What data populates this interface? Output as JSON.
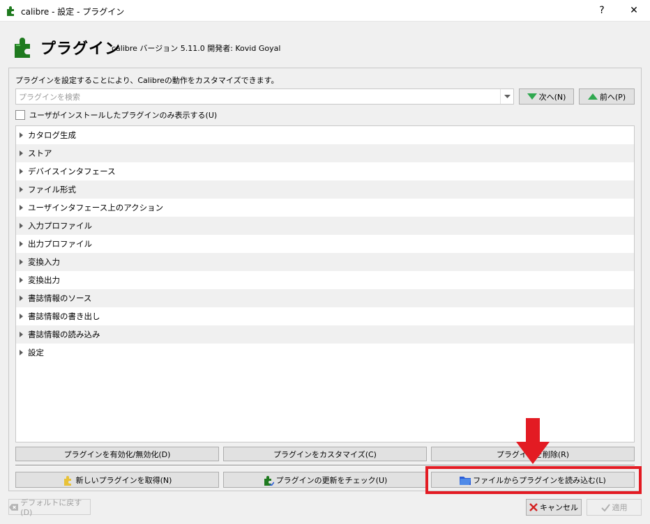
{
  "window": {
    "title": "calibre - 設定 - プラグイン",
    "help": "?",
    "close": "✕"
  },
  "header": {
    "title": "プラグイン",
    "subtitle": "calibre バージョン 5.11.0 開発者: Kovid Goyal"
  },
  "description": "プラグインを設定することにより、Calibreの動作をカスタマイズできます。",
  "search": {
    "placeholder": "プラグインを検索",
    "value": ""
  },
  "nav": {
    "next": "次へ(N)",
    "prev": "前へ(P)"
  },
  "filter_label": "ユーザがインストールしたプラグインのみ表示する(U)",
  "categories": [
    "カタログ生成",
    "ストア",
    "デバイスインタフェース",
    "ファイル形式",
    "ユーザインタフェース上のアクション",
    "入力プロファイル",
    "出力プロファイル",
    "変換入力",
    "変換出力",
    "書誌情報のソース",
    "書誌情報の書き出し",
    "書誌情報の読み込み",
    "設定"
  ],
  "actions": {
    "toggle": "プラグインを有効化/無効化(D)",
    "customize": "プラグインをカスタマイズ(C)",
    "remove": "プラグインを削除(R)",
    "get_new": "新しいプラグインを取得(N)",
    "check_updates": "プラグインの更新をチェック(U)",
    "load_from_file": "ファイルからプラグインを読み込む(L)"
  },
  "footer": {
    "restore_defaults": "デフォルトに戻す(D)",
    "cancel": "キャンセル",
    "apply": "適用"
  },
  "colors": {
    "highlight": "#e31b23",
    "puzzle_green": "#1f7a1f",
    "nav_arrow": "#2fa84f"
  }
}
